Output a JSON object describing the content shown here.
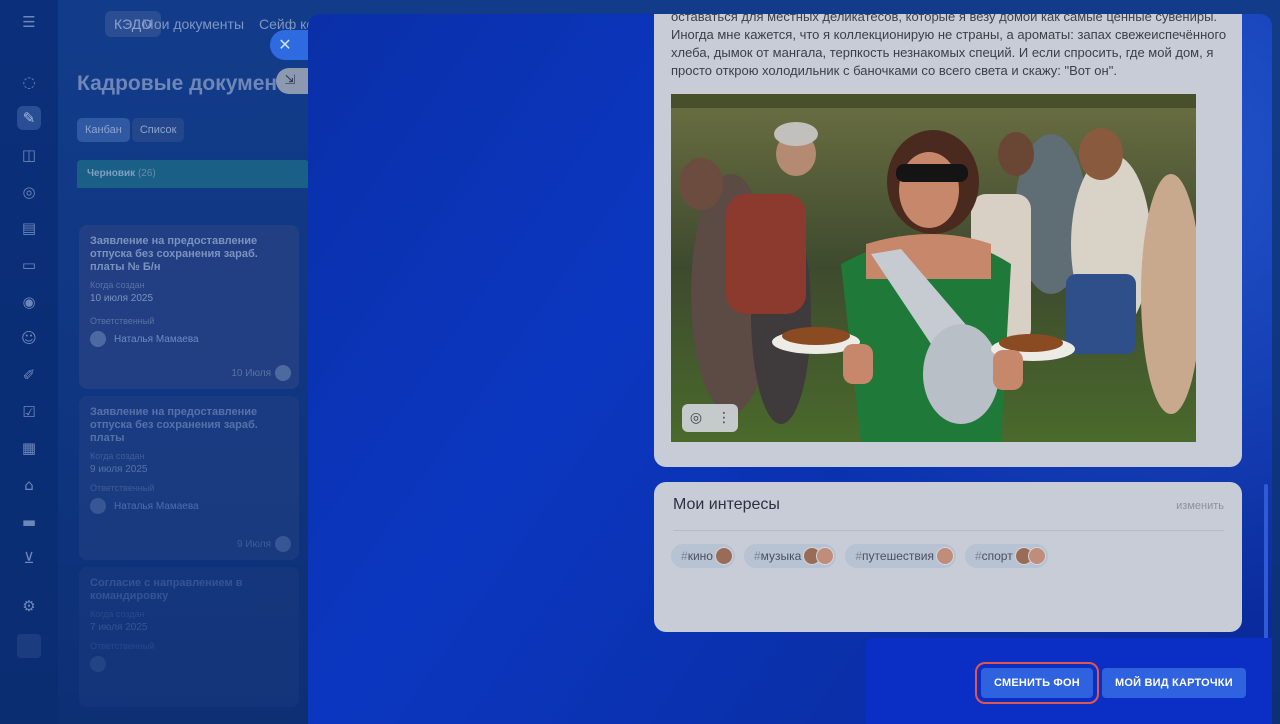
{
  "rail": {
    "icons": [
      "menu-icon",
      "pulse-icon",
      "documents-icon",
      "chat-icon",
      "feed-icon",
      "tasks-icon",
      "mail-icon",
      "target-icon",
      "contacts-icon",
      "sign-icon",
      "checklist-icon",
      "calendar-icon",
      "store-icon",
      "card-icon",
      "cart-icon",
      "settings-icon"
    ]
  },
  "topnav": {
    "kedo": "КЭДО",
    "my_documents": "Мои документы",
    "safe": "Сейф ко"
  },
  "page": {
    "title": "Кадровые докумен",
    "view_kanban": "Канбан",
    "view_list": "Список"
  },
  "kanban": {
    "column_title": "Черновик",
    "column_count": "(26)",
    "cards": [
      {
        "title": "Заявление на предоставление отпуска без сохранения зараб. платы № Б/н",
        "created_label": "Когда создан",
        "created": "10 июля 2025",
        "owner_label": "Ответственный",
        "owner": "Наталья Мамаева",
        "footer": "10 Июля"
      },
      {
        "title": "Заявление на предоставление отпуска без сохранения зараб. платы",
        "created_label": "Когда создан",
        "created": "9 июля 2025",
        "owner_label": "Ответственный",
        "owner": "Наталья Мамаева",
        "footer": "9 Июля"
      },
      {
        "title": "Согласие с направлением в командировку",
        "created_label": "Когда создан",
        "created": "7 июля 2025",
        "owner_label": "Ответственный",
        "owner": ""
      }
    ]
  },
  "post": {
    "text": "оставаться для местных деликатесов, которые я везу домой как самые ценные сувениры. Иногда мне кажется, что я коллекционирую не страны, а ароматы: запах свежеиспечённого хлеба, дымок от мангала, терпкость незнакомых специй. И если спросить, где мой дом, я просто открою холодильник с баночками со всего света и скажу: \"Вот он\"."
  },
  "interests": {
    "title": "Мои интересы",
    "edit": "изменить",
    "tags": [
      {
        "label": "кино"
      },
      {
        "label": "музыка"
      },
      {
        "label": "путешествия"
      },
      {
        "label": "спорт"
      }
    ]
  },
  "actions": {
    "change_background": "СМЕНИТЬ ФОН",
    "my_card_view": "МОЙ ВИД КАРТОЧКИ"
  },
  "colors": {
    "overlay": "#0b2fc4",
    "accent_button": "#2e62df",
    "highlight_outline": "#e0574f"
  }
}
